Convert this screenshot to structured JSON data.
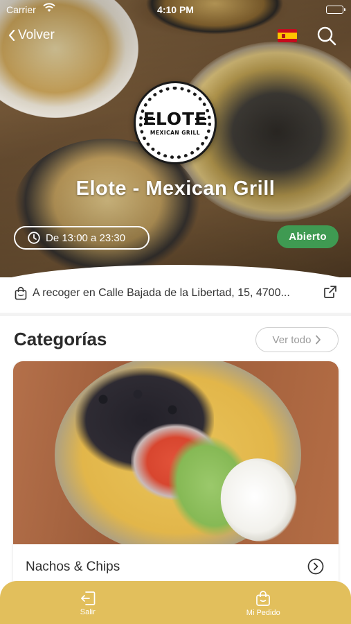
{
  "status_bar": {
    "carrier": "Carrier",
    "time": "4:10 PM"
  },
  "nav": {
    "back_label": "Volver",
    "language_flag": "spain-flag",
    "search_icon": "search-icon"
  },
  "restaurant": {
    "logo_text": "ELOTE",
    "logo_subtext": "MEXICAN GRILL",
    "name": "Elote - Mexican Grill",
    "hours": "De 13:00 a 23:30",
    "status": "Abierto"
  },
  "pickup": {
    "text": "A recoger en Calle Bajada de la Libertad, 15, 4700..."
  },
  "categories": {
    "title": "Categorías",
    "see_all": "Ver todo",
    "items": [
      {
        "label": "Nachos & Chips"
      }
    ]
  },
  "bottom_nav": {
    "items": [
      {
        "label": "Salir",
        "icon": "exit-icon"
      },
      {
        "label": "Mi Pedido",
        "icon": "shopping-bag-icon"
      }
    ]
  },
  "colors": {
    "accent": "#e2bf5c",
    "open_badge": "#3f9a52",
    "text_dark": "#2b2b2b"
  }
}
